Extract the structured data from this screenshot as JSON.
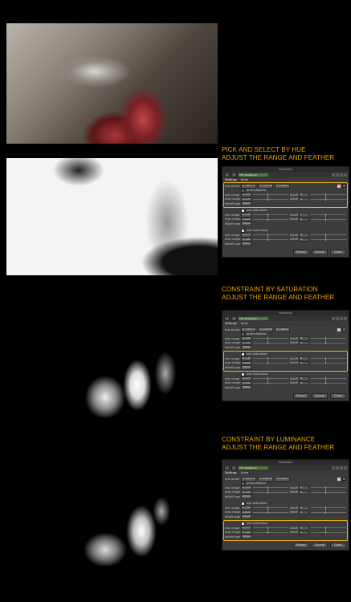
{
  "headings": [
    {
      "line1": "PICK AND SELECT BY HUE",
      "line2": "ADJUST THE RANGE AND FEATHER"
    },
    {
      "line1": "CONSTRAINT BY SATURATION",
      "line2": "ADJUST THE RANGE AND FEATHER"
    },
    {
      "line1": "CONSTRAINT BY LUMINANCE",
      "line2": "ADJUST THE RANGE AND FEATHER"
    }
  ],
  "panel": {
    "title": "Properties",
    "node_name": "TFX_PixelHue1",
    "tabs": [
      "Settings",
      "Node"
    ],
    "hue_picker_label": "hue picker",
    "hue_values": [
      "0.165134",
      "0.034906",
      "0.038541"
    ],
    "premultiplied_label": "premultiplied",
    "min_range_label": "min range",
    "max_range_label": "max range",
    "falloff_label": "falloff",
    "falloff_type_label": "falloff type",
    "falloff_type_value": "smooth",
    "hue_min": "0.110",
    "hue_max": "0.195",
    "sat_label": "use saturation",
    "sat_min": "0.235",
    "sat_max": "0.820",
    "lum_label": "use luminance",
    "lum_min": "0.175",
    "lum_max": "0.580",
    "falloff_val": "0",
    "buttons": {
      "revert": "Revert",
      "cancel": "Cancel",
      "close": "Close"
    }
  },
  "colors": {
    "accent": "#f0a500",
    "node_green": "#4b7a3a"
  }
}
